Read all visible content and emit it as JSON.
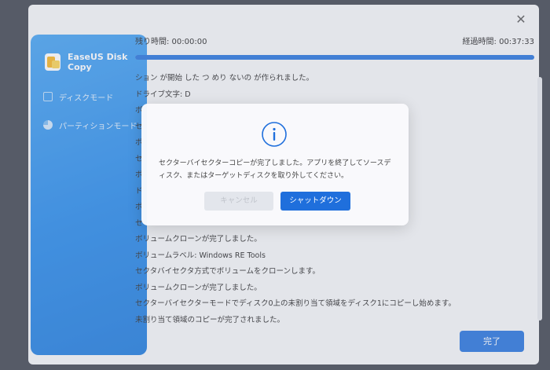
{
  "window": {
    "close_glyph": "✕"
  },
  "app": {
    "name": "EaseUS Disk Copy"
  },
  "sidebar": {
    "items": [
      {
        "label": "ディスクモード",
        "icon": "disk-icon"
      },
      {
        "label": "パーティションモード",
        "icon": "pie-chart-icon"
      }
    ]
  },
  "status": {
    "remaining_label": "残り時間: 00:00:00",
    "elapsed_label": "経過時間: 00:37:33",
    "progress_percent": 100
  },
  "log": {
    "lines": [
      "ション が開始 した つ めり ないの が作られました。",
      "ドライブ文字: D",
      "ボ",
      "セ",
      "ボ",
      "セ",
      "ボ",
      "ド",
      "ボ",
      "セ",
      "ボリュームクローンが完了しました。",
      "ボリュームラベル: Windows RE Tools",
      "セクタバイセクタ方式でボリュームをクローンします。",
      "ボリュームクローンが完了しました。",
      "セクターバイセクターモードでディスク0上の未割り当て領域をディスク1にコピーし始めます。",
      "未割り当て領域のコピーが完了されました。"
    ]
  },
  "footer": {
    "done_label": "完了"
  },
  "dialog": {
    "message": "セクターバイセクターコピーが完了しました。アプリを終了してソースディスク、またはターゲットディスクを取り外してください。",
    "cancel_label": "キャンセル",
    "shutdown_label": "シャットダウン",
    "info_icon": "info-icon"
  },
  "colors": {
    "accent": "#1f6fdc",
    "sidebar": "#1f86ea"
  }
}
